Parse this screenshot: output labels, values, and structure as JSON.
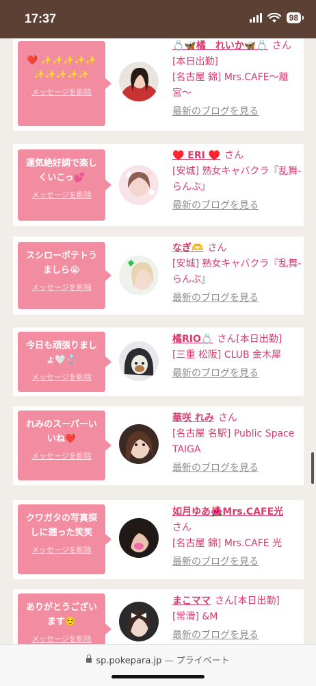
{
  "status_bar": {
    "time": "17:37",
    "battery": "98"
  },
  "cards": [
    {
      "message": "❤️ ✨✨✨✨✨✨✨✨✨✨",
      "delete_label": "メッセージを削除",
      "name": "💍🦋橘　れいか🦋💍",
      "san": "さん",
      "badge": "[本日出勤]",
      "shop": "[名古屋 錦] Mrs.CAFE〜離宮〜",
      "blog_link": "最新のブログを見る"
    },
    {
      "message": "運気絶好調で楽しくいこっ💕",
      "delete_label": "メッセージを削除",
      "name": "♥️ ERI ♥️",
      "san": "さん",
      "badge": "",
      "shop": "[安城] 熟女キャバクラ『乱舞-らんぶ』",
      "blog_link": "最新のブログを見る"
    },
    {
      "message": "スシローポテトうましら😭",
      "delete_label": "メッセージを削除",
      "name": "なぎ🫶",
      "san": "さん",
      "badge": "",
      "shop": "[安城] 熟女キャバクラ『乱舞-らんぶ』",
      "blog_link": "最新のブログを見る"
    },
    {
      "message": "今日も頑張りましょ🤍💍",
      "delete_label": "メッセージを削除",
      "name": "橘RIO💍",
      "san": "さん",
      "badge": "[本日出勤]",
      "shop": "[三重 松阪] CLUB 金木犀",
      "blog_link": "最新のブログを見る"
    },
    {
      "message": "れみのスーパーいいね❤️",
      "delete_label": "メッセージを削除",
      "name": "華咲 れみ",
      "san": "さん",
      "badge": "",
      "shop": "[名古屋 名駅] Public Space TAIGA",
      "blog_link": "最新のブログを見る"
    },
    {
      "message": "クワガタの写真探しに遡った笑笑",
      "delete_label": "メッセージを削除",
      "name": "如月ゆあ🌺Mrs.CAFE光",
      "san": "さん",
      "badge": "",
      "shop": "[名古屋 錦] Mrs.CAFE 光",
      "blog_link": "最新のブログを見る"
    },
    {
      "message": "ありがとうございます☺️",
      "delete_label": "メッセージを削除",
      "name": "まこママ",
      "san": "さん",
      "badge": "[本日出勤]",
      "shop": "[常滑] &M",
      "blog_link": "最新のブログを見る"
    }
  ],
  "browser": {
    "domain": "sp.pokepara.jp",
    "mode": "— プライベート"
  },
  "colors": {
    "accent_pink": "#f28ca0",
    "name_pink": "#d93b6d",
    "status_bar_brown": "#5c4033"
  }
}
